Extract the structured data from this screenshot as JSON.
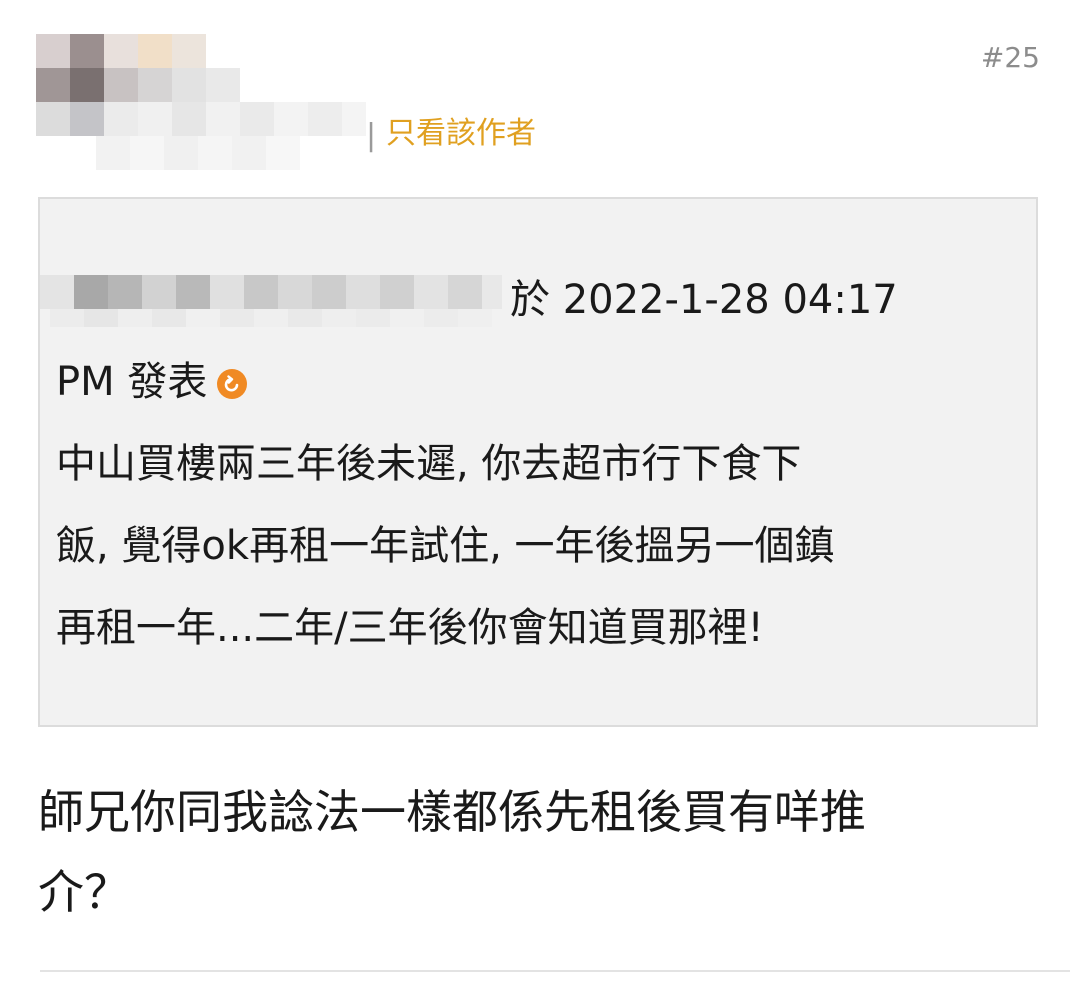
{
  "header": {
    "separator": "|",
    "only_author_label": "只看該作者",
    "floor": "#25"
  },
  "quote": {
    "meta_line": "於 2022-1-28 04:17",
    "meta_line2": "PM 發表",
    "body_lines": [
      "中山買樓兩三年後未遲, 你去超市行下食下",
      "飯, 覺得ok再租一年試住, 一年後搵另一個鎮",
      "再租一年...二年/三年後你會知道買那裡!"
    ]
  },
  "reply": {
    "lines": [
      "師兄你同我諗法一樣都係先租後買有咩推",
      "介？"
    ]
  },
  "colors": {
    "accent": "#e0a020",
    "jump_icon": "#f08a24",
    "quote_bg": "#f2f2f2"
  },
  "icons": {
    "jump": "jump-to-post-icon"
  }
}
